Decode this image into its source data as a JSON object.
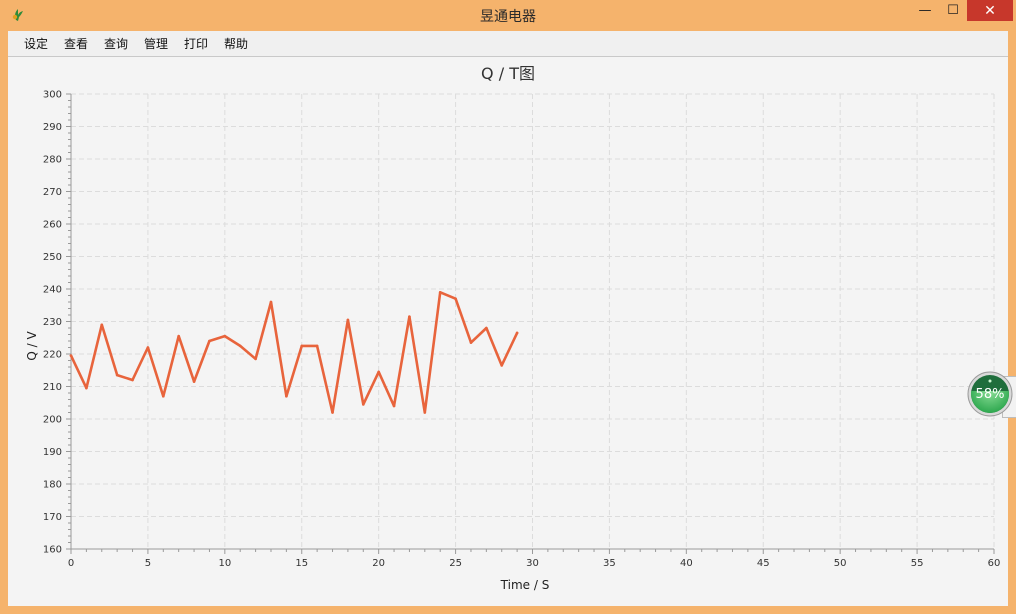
{
  "window": {
    "title": "昱通电器",
    "app_icon": "app-logo-icon",
    "controls": {
      "minimize": "—",
      "maximize": "☐",
      "close": "✕"
    }
  },
  "menu": {
    "items": [
      {
        "label": "设定"
      },
      {
        "label": "查看"
      },
      {
        "label": "查询"
      },
      {
        "label": "管理"
      },
      {
        "label": "打印"
      },
      {
        "label": "帮助"
      }
    ]
  },
  "chart_data": {
    "type": "line",
    "title": "Q / T图",
    "xlabel": "Time / S",
    "ylabel": "Q  /  V",
    "xlim": [
      0,
      60
    ],
    "ylim": [
      160,
      300
    ],
    "xticks": [
      0,
      5,
      10,
      15,
      20,
      25,
      30,
      35,
      40,
      45,
      50,
      55,
      60
    ],
    "yticks": [
      160,
      170,
      180,
      190,
      200,
      210,
      220,
      230,
      240,
      250,
      260,
      270,
      280,
      290,
      300
    ],
    "grid": true,
    "line_color": "#e8643c",
    "series": [
      {
        "x": [
          0,
          1,
          2,
          3,
          4,
          5,
          6,
          7,
          8,
          9,
          10,
          11,
          12,
          13,
          14,
          15,
          16,
          17,
          18,
          19,
          20,
          21,
          22,
          23,
          24,
          25,
          26,
          27,
          28,
          29
        ],
        "y": [
          219.5,
          209.5,
          229,
          213.5,
          212,
          222,
          207,
          225.5,
          211.5,
          224,
          225.5,
          222.5,
          218.5,
          236,
          207,
          222.5,
          222.5,
          202,
          230.5,
          204.5,
          214.5,
          204,
          231.5,
          202,
          239,
          237,
          223.5,
          228,
          216.5,
          226.5
        ]
      }
    ]
  },
  "progress_widget": {
    "percent": 58,
    "label": "58%",
    "color": "#2ea84f"
  }
}
